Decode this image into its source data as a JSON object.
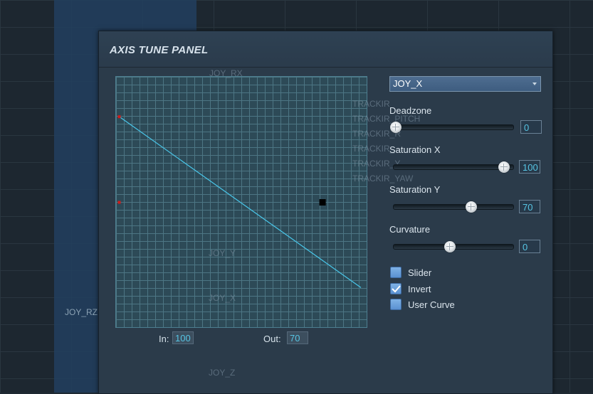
{
  "background": {
    "left_label": "JOY_RZ",
    "ghost_labels": [
      "JOY_RX",
      "TRACKIR",
      "TRACKIR_PITCH",
      "TRACKIR_R",
      "TRACKIR_",
      "TRACKIR_Y",
      "TRACKIR_YAW",
      "JOY_Y",
      "JOY_X",
      "JOY_Z"
    ]
  },
  "panel": {
    "title": "AXIS TUNE PANEL",
    "axis_select": {
      "value": "JOY_X"
    },
    "deadzone": {
      "label": "Deadzone",
      "value": "0",
      "level": 0.0
    },
    "saturation_x": {
      "label": "Saturation X",
      "value": "100",
      "level": 1.0
    },
    "saturation_y": {
      "label": "Saturation Y",
      "value": "70",
      "level": 0.7
    },
    "curvature": {
      "label": "Curvature",
      "value": "0",
      "level": 0.5
    },
    "checkboxes": [
      {
        "label": "Slider",
        "checked": false
      },
      {
        "label": "Invert",
        "checked": true
      },
      {
        "label": "User Curve",
        "checked": false
      }
    ],
    "in_label": "In:",
    "in_value": "100",
    "out_label": "Out:",
    "out_value": "70"
  },
  "curve": {
    "x_range": [
      0,
      1
    ],
    "y_range": [
      0,
      1
    ],
    "points": [
      [
        0,
        0.85
      ],
      [
        1,
        0.15
      ]
    ],
    "control_points": [
      [
        0,
        0.85
      ],
      [
        0,
        0.5
      ]
    ],
    "current_point": [
      0.84,
      0.5
    ],
    "line_color": "#49c7ea",
    "control_color": "#d11a1a",
    "marker_color": "#000000"
  }
}
